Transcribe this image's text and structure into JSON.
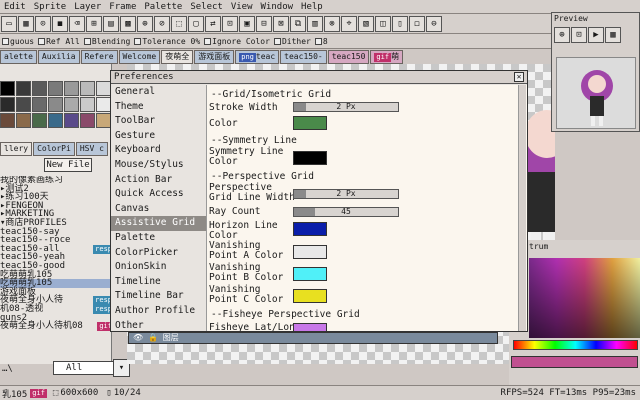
{
  "menubar": {
    "items": [
      "Edit",
      "Sprite",
      "Layer",
      "Frame",
      "Palette",
      "Select",
      "View",
      "Window",
      "Help"
    ]
  },
  "toolbar": {
    "icons": [
      "▭",
      "▦",
      "⊙",
      "◼",
      "⌫",
      "⊞",
      "▤",
      "▩",
      "⊕",
      "⊘",
      "⬚",
      "▢",
      "⇄",
      "⊡",
      "▣",
      "⊟",
      "⊠",
      "⧉",
      "▥",
      "⊗",
      "⌖",
      "▧",
      "◫",
      "▯",
      "◻",
      "⊖"
    ]
  },
  "options": {
    "items": [
      "guous",
      "Ref All",
      "Blending",
      "Tolerance 0%",
      "Ignore Color",
      "Dither",
      "8"
    ]
  },
  "doc_tabs": [
    {
      "label": "alette"
    },
    {
      "label": "Auxilia"
    },
    {
      "label": "Refere"
    },
    {
      "label": "Welcome"
    },
    {
      "label": "夜萌全"
    },
    {
      "label": "游戏面板"
    },
    {
      "label": "teac",
      "tag": "png"
    },
    {
      "label": "teac150-"
    },
    {
      "label": "teac150"
    },
    {
      "label": "萌",
      "tag": "gif"
    }
  ],
  "left": {
    "tabs2": [
      "llery",
      "ColorPi",
      "HSV c"
    ],
    "new_file": "New File",
    "files": [
      {
        "name": "我的像素画练习"
      },
      {
        "name": "▸测试2"
      },
      {
        "name": "▸练习100天"
      },
      {
        "name": "▸FENGEON"
      },
      {
        "name": "▸MARKETING"
      },
      {
        "name": "▾商店PROFILES"
      },
      {
        "name": "  teac150-say"
      },
      {
        "name": "  teac150--roce"
      },
      {
        "name": "  teac150-all",
        "tag": "resp"
      },
      {
        "name": "  teac150-yeah"
      },
      {
        "name": "  teac150-good"
      },
      {
        "name": "  吃萌萌乳105"
      },
      {
        "name": "  吃萌萌乳105",
        "selected": true
      },
      {
        "name": "  游戏面板"
      },
      {
        "name": "  夜萌全身小人待",
        "tag": "resp"
      },
      {
        "name": "  机08-透视",
        "tag": "resp"
      },
      {
        "name": "  guns2"
      },
      {
        "name": "  夜萌全身小人待机08",
        "tag": "gif"
      }
    ],
    "filter_value": "All"
  },
  "preview": {
    "title": "Preview"
  },
  "spectrum": {
    "title": "trum"
  },
  "layer": {
    "name": "图层"
  },
  "status": {
    "file": "乳105",
    "file_tag": "gif",
    "size": "600x600",
    "frames": "10/24",
    "perf": "RFPS=524 FT=13ms P95=23ms"
  },
  "dialog": {
    "title": "Preferences",
    "close": "✕",
    "categories": [
      "General",
      "Theme",
      "ToolBar",
      "Gesture",
      "Keyboard",
      "Mouse/Stylus",
      "Action Bar",
      "Quick Access",
      "Canvas",
      "Assistive Grid",
      "Palette",
      "ColorPicker",
      "OnionSkin",
      "Timeline",
      "Timeline Bar",
      "Author Profile",
      "Other"
    ],
    "active_category": "Assistive Grid",
    "sections": {
      "grid": "--Grid/Isometric Grid",
      "symmetry": "--Symmetry Line",
      "perspective": "--Perspective Grid",
      "fisheye": "--Fisheye Perspective Grid"
    },
    "rows": {
      "stroke_width": {
        "label": "Stroke Width",
        "value": "2 Px",
        "level": 0.12
      },
      "grid_color": {
        "label": "Color",
        "color": "#4a8a4a"
      },
      "sym_color": {
        "label": "Symmetry Line Color",
        "color": "#000000"
      },
      "persp_width": {
        "label": "Perspective Grid Line Width",
        "value": "2 Px",
        "level": 0.12
      },
      "ray_count": {
        "label": "Ray Count",
        "value": "45",
        "level": 0.2
      },
      "horizon_color": {
        "label": "Horizon Line Color",
        "color": "#0a1eaa"
      },
      "vpa_color": {
        "label": "Vanishing Point A Color",
        "color": "#e8e8e8"
      },
      "vpb_color": {
        "label": "Vanishing Point B Color",
        "color": "#50f0f8"
      },
      "vpc_color": {
        "label": "Vanishing Point C Color",
        "color": "#e8e020"
      },
      "fisheye_lat": {
        "label": "Fisheye Lat/Lon",
        "color": "#c878e8"
      }
    }
  }
}
